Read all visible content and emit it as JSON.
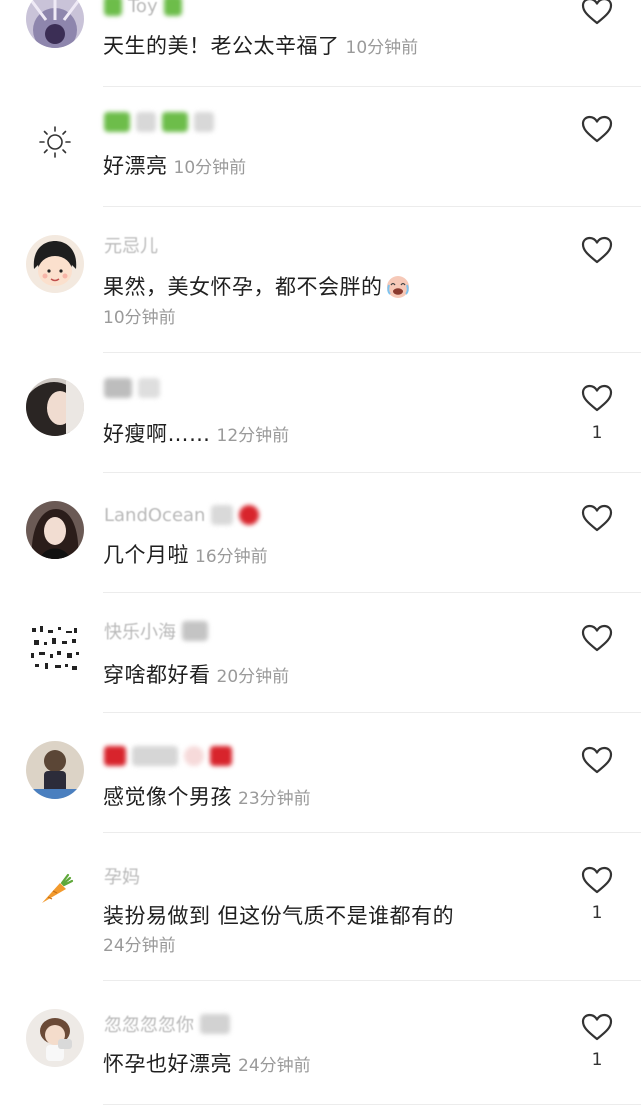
{
  "comments": [
    {
      "username": "Toy",
      "text": "天生的美！老公太辛福了",
      "time": "10分钟前",
      "likes": ""
    },
    {
      "username": "",
      "text": "好漂亮",
      "time": "10分钟前",
      "likes": ""
    },
    {
      "username": "元忌儿",
      "text": "果然，美女怀孕，都不会胖的",
      "time": "10分钟前",
      "likes": "",
      "emoji": "crying-laughing-emoji"
    },
    {
      "username": "",
      "text": "好瘦啊……",
      "time": "12分钟前",
      "likes": "1"
    },
    {
      "username": "LandOcean",
      "text": "几个月啦",
      "time": "16分钟前",
      "likes": ""
    },
    {
      "username": "快乐小海",
      "text": "穿啥都好看",
      "time": "20分钟前",
      "likes": ""
    },
    {
      "username": "",
      "text": "感觉像个男孩",
      "time": "23分钟前",
      "likes": ""
    },
    {
      "username": "孕妈",
      "text": "装扮易做到 但这份气质不是谁都有的",
      "time": "24分钟前",
      "likes": "1"
    },
    {
      "username": "忽忽忽忽你",
      "text": "怀孕也好漂亮",
      "time": "24分钟前",
      "likes": "1"
    }
  ],
  "icons": {
    "like": "heart-outline-icon",
    "avatar_sun": "sun-icon",
    "avatar_carrot": "carrot-icon"
  },
  "colors": {
    "text": "#1f1f1f",
    "time": "#9a9a9a",
    "username": "#b9b9b9",
    "heart_stroke": "#333333",
    "divider": "#ececec"
  }
}
